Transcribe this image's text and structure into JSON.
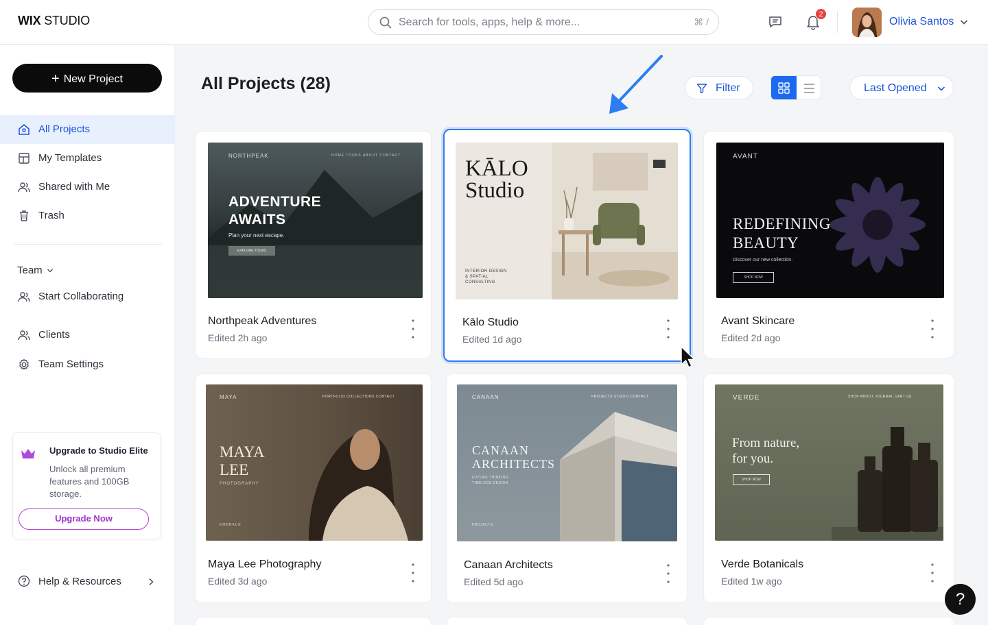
{
  "app": {
    "logo_bold": "WIX",
    "logo_rest": " STUDIO"
  },
  "search": {
    "placeholder": "Search for tools, apps, help & more...",
    "shortcut": "⌘ /"
  },
  "header": {
    "notifications": "2",
    "user_name": "Olivia Santos"
  },
  "sidebar": {
    "new_project": "New Project",
    "items": [
      {
        "label": "All Projects",
        "icon": "home-icon"
      },
      {
        "label": "My Templates",
        "icon": "template-icon"
      },
      {
        "label": "Shared with Me",
        "icon": "users-icon"
      },
      {
        "label": "Trash",
        "icon": "trash-icon"
      }
    ],
    "team_label": "Team",
    "team_items": [
      {
        "label": "Start Collaborating",
        "icon": "users-icon"
      },
      {
        "label": "Clients",
        "icon": "users-icon"
      },
      {
        "label": "Team Settings",
        "icon": "gear-icon"
      }
    ],
    "upgrade": {
      "title": "Upgrade to Studio Elite",
      "desc": "Unlock all premium features and 100GB storage.",
      "button": "Upgrade Now"
    },
    "help": "Help & Resources"
  },
  "main": {
    "title": "All Projects (28)",
    "filter": "Filter",
    "sort": "Last Opened",
    "projects": [
      {
        "name": "Northpeak Adventures",
        "edited": "Edited 2h ago"
      },
      {
        "name": "Kālo Studio",
        "edited": "Edited 1d ago"
      },
      {
        "name": "Avant Skincare",
        "edited": "Edited 2d ago"
      },
      {
        "name": "Maya Lee Photography",
        "edited": "Edited 3d ago"
      },
      {
        "name": "Canaan Architects",
        "edited": "Edited 5d ago"
      },
      {
        "name": "Verde Botanicals",
        "edited": "Edited 1w ago"
      }
    ],
    "thumbs": {
      "northpeak": {
        "brand": "NORTHPEAK",
        "nav": "HOME   TOURS   ABOUT   CONTACT",
        "headline1": "ADVENTURE",
        "headline2": "AWAITS",
        "sub": "Plan your next escape.",
        "cta": "EXPLORE TOURS"
      },
      "kalo": {
        "h1": "KĀLO",
        "h2": "Studio",
        "sub": "INTERIOR DESIGN\n& SPATIAL\nCONSULTING"
      },
      "avant": {
        "brand": "AVANT",
        "h1": "REDEFINING",
        "h2": "BEAUTY",
        "sub": "Discover our new collection.",
        "cta": "SHOP NOW"
      },
      "maya": {
        "brand": "MAYA",
        "nav": "PORTFOLIO   COLLECTIONS   CONTACT",
        "h1": "MAYA",
        "h2": "LEE",
        "sub": "PHOTOGRAPHY",
        "foot": "EMBRACE"
      },
      "canaan": {
        "brand": "CANAAN",
        "nav": "PROJECTS   STUDIO   CONTACT",
        "h1": "CANAAN",
        "h2": "ARCHITECTS",
        "sub": "FUTURE THINKING\nTIMELESS DESIGN",
        "foot": "PROJECTS"
      },
      "verde": {
        "brand": "VERDE",
        "nav": "SHOP   ABOUT   JOURNAL   CART (0)",
        "h1": "From nature,",
        "h2": "for you.",
        "cta": "SHOP NOW"
      }
    }
  },
  "colors": {
    "accent": "#1b56d9",
    "selected_border": "#2b7df2",
    "upgrade": "#a033c9",
    "badge": "#e8413b"
  }
}
